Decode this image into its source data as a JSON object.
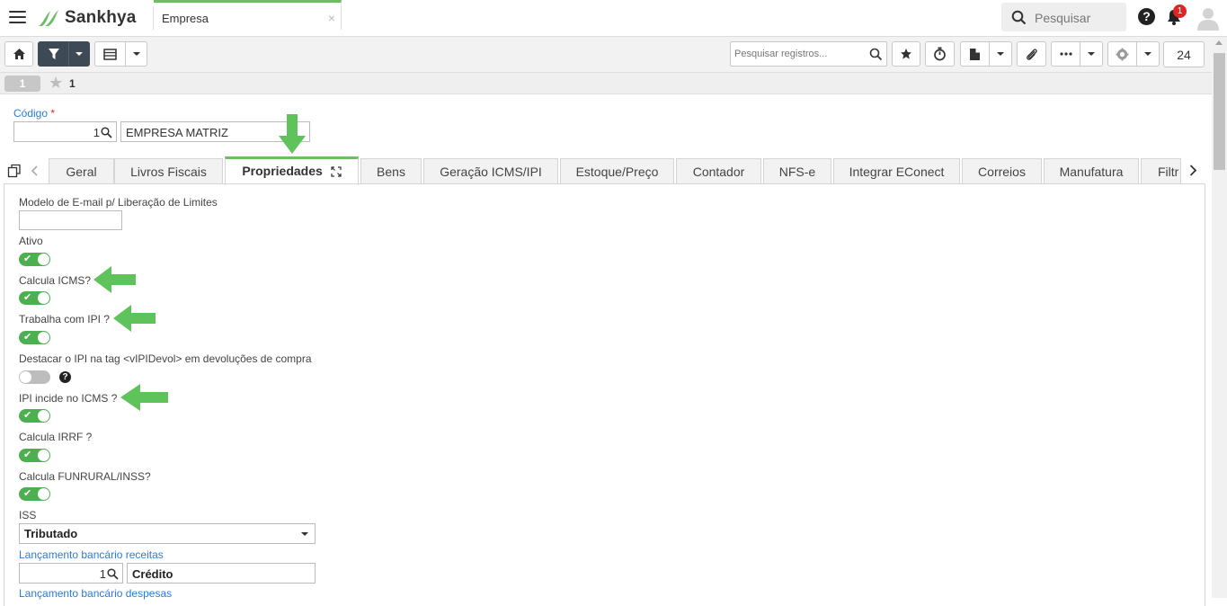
{
  "app": {
    "brand": "Sankhya",
    "tab_title": "Empresa",
    "tab_close": "×",
    "brand_color": "#6dbd63"
  },
  "header": {
    "search_placeholder": "Pesquisar",
    "notification_count": "1",
    "help": "?"
  },
  "toolbar": {
    "records_search_placeholder": "Pesquisar registros...",
    "record_count": "24"
  },
  "record_nav": {
    "current": "1",
    "favorite_index": "1"
  },
  "form_header": {
    "code_label": "Código",
    "required_mark": "*",
    "code_value": "1",
    "name_value": "EMPRESA MATRIZ"
  },
  "tabs": [
    {
      "label": "Geral"
    },
    {
      "label": "Livros Fiscais"
    },
    {
      "label": "Propriedades",
      "active": true
    },
    {
      "label": "Bens"
    },
    {
      "label": "Geração ICMS/IPI"
    },
    {
      "label": "Estoque/Preço"
    },
    {
      "label": "Contador"
    },
    {
      "label": "NFS-e"
    },
    {
      "label": "Integrar EConect"
    },
    {
      "label": "Correios"
    },
    {
      "label": "Manufatura"
    },
    {
      "label": "Filtr"
    }
  ],
  "fields": {
    "email_model_label": "Modelo de E-mail p/ Liberação de Limites",
    "email_model_value": "",
    "ativo_label": "Ativo",
    "ativo_on": true,
    "calcula_icms_label": "Calcula ICMS?",
    "calcula_icms_on": true,
    "trabalha_ipi_label": "Trabalha com IPI ?",
    "trabalha_ipi_on": true,
    "destacar_ipi_label": "Destacar o IPI na tag <vIPIDevol> em devoluções de compra",
    "destacar_ipi_on": false,
    "ipi_incide_label": "IPI incide no ICMS ?",
    "ipi_incide_on": true,
    "calcula_irrf_label": "Calcula IRRF ?",
    "calcula_irrf_on": true,
    "calcula_funrural_label": "Calcula FUNRURAL/INSS?",
    "calcula_funrural_on": true,
    "iss_label": "ISS",
    "iss_value": "Tributado",
    "lanc_receitas_label": "Lançamento bancário receitas",
    "lanc_receitas_code": "1",
    "lanc_receitas_desc": "Crédito",
    "lanc_despesas_label": "Lançamento bancário despesas"
  },
  "colors": {
    "accent_green": "#6dbd63",
    "toggle_on": "#4caf50",
    "link_blue": "#2a7cd6",
    "annotation_arrow": "#5dc35a"
  }
}
